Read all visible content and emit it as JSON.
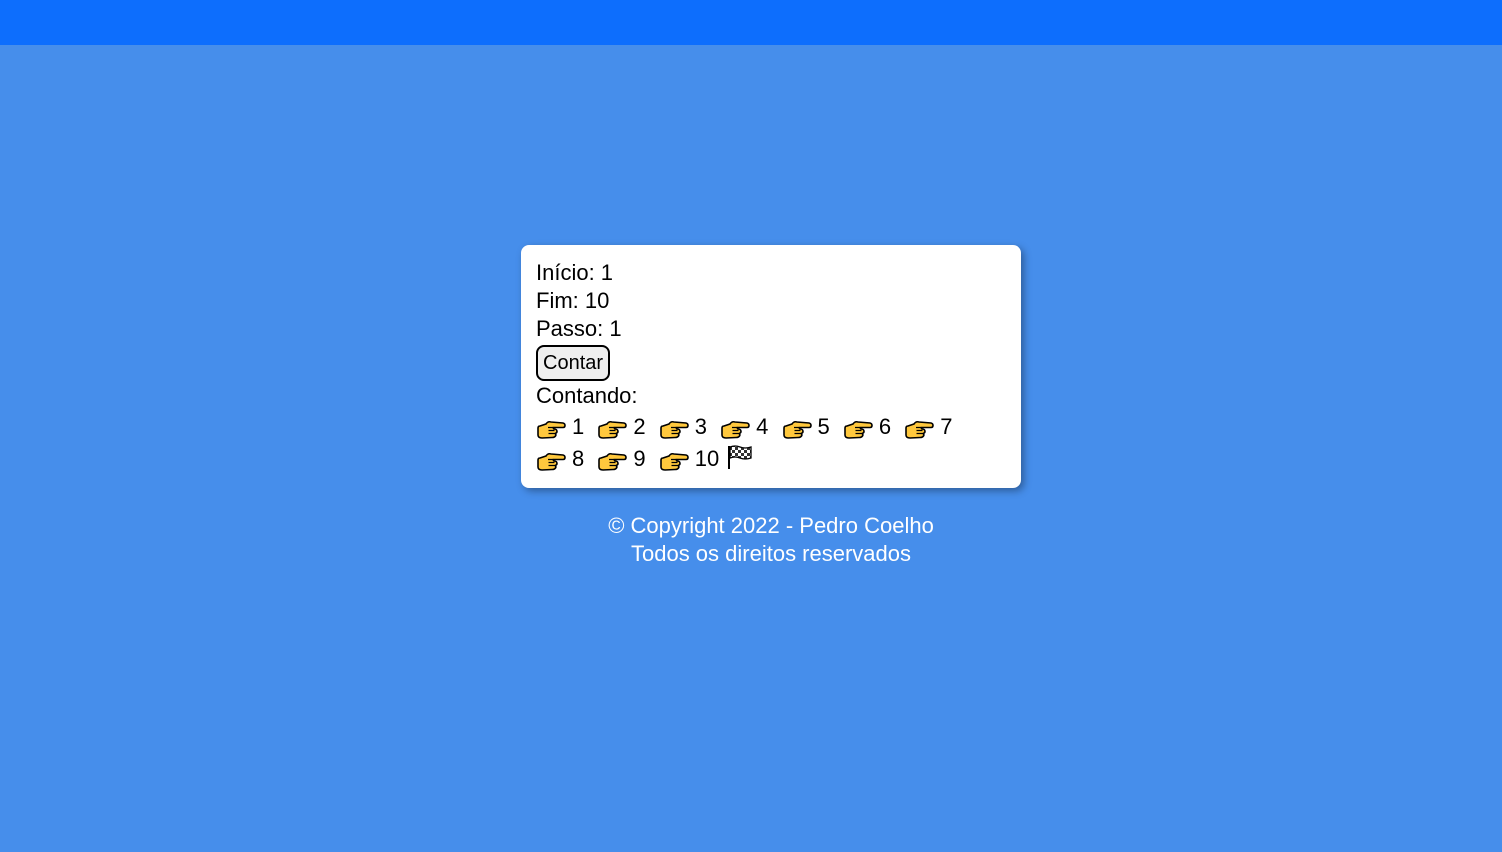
{
  "card": {
    "inicio": "Início: 1",
    "fim": "Fim: 10",
    "passo": "Passo: 1",
    "button_label": "Contar",
    "contando_label": "Contando:",
    "sequence": [
      "1",
      "2",
      "3",
      "4",
      "5",
      "6",
      "7",
      "8",
      "9",
      "10"
    ],
    "pointer_icon": "backhand-index-pointing-right-icon",
    "end_icon": "chequered-flag-icon"
  },
  "footer": {
    "copyright": "© Copyright 2022 - Pedro Coelho",
    "rights": "Todos os direitos reservados"
  },
  "colors": {
    "topbar": "#0d6efd",
    "background": "#468eeb",
    "card": "#ffffff",
    "hand": "#ffc83d"
  }
}
